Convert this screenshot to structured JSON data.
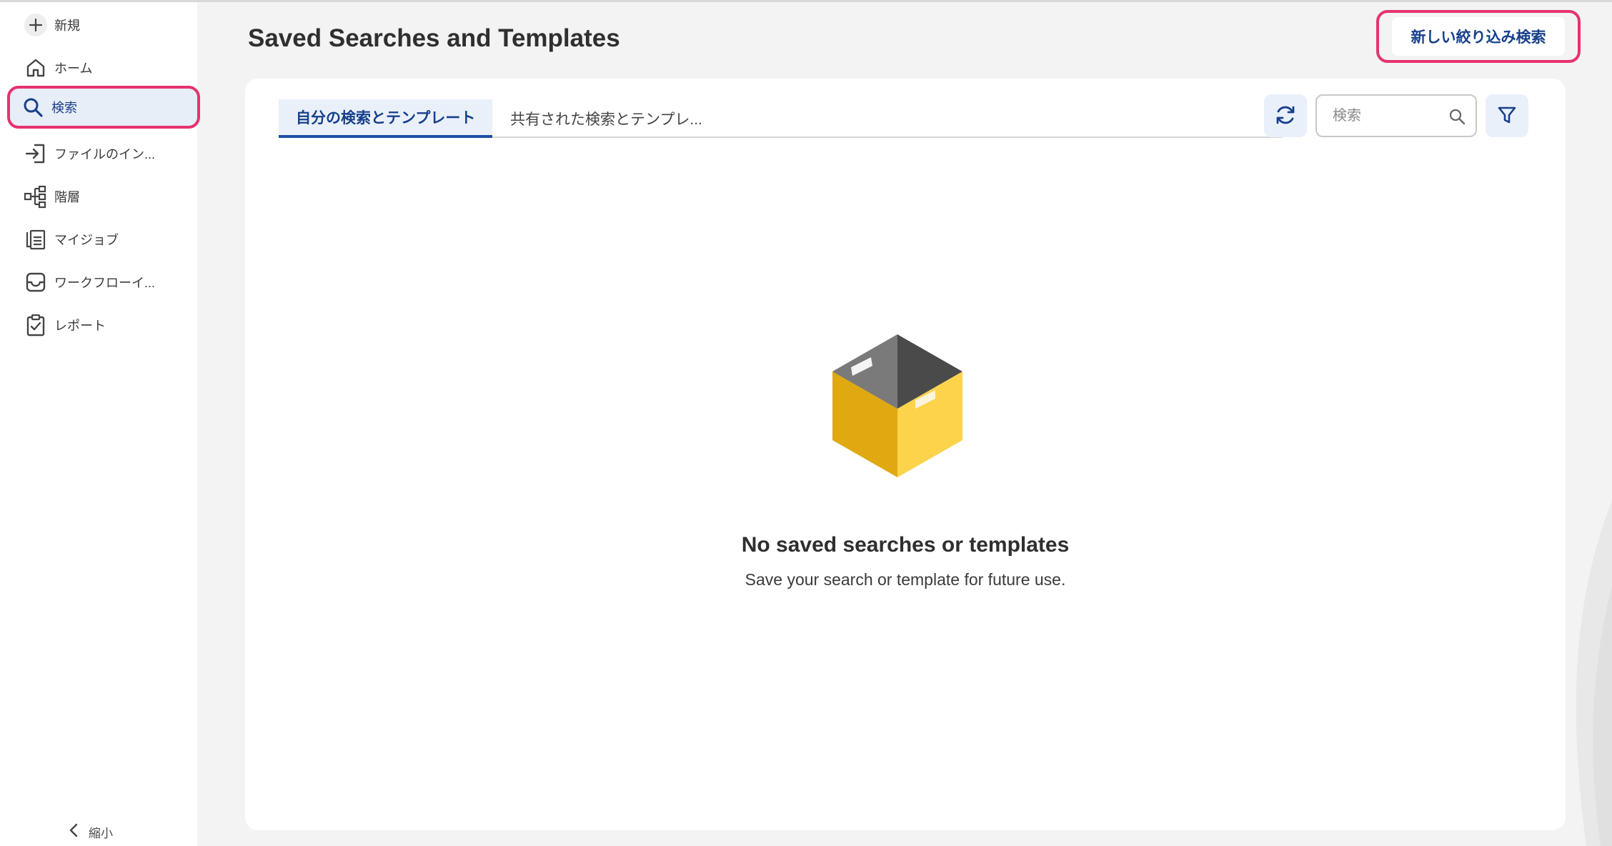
{
  "sidebar": {
    "items": [
      {
        "label": "新規",
        "icon": "plus-icon"
      },
      {
        "label": "ホーム",
        "icon": "home-icon"
      },
      {
        "label": "検索",
        "icon": "search-icon"
      },
      {
        "label": "ファイルのイン...",
        "icon": "import-icon"
      },
      {
        "label": "階層",
        "icon": "hierarchy-icon"
      },
      {
        "label": "マイジョブ",
        "icon": "jobs-icon"
      },
      {
        "label": "ワークフローイ...",
        "icon": "inbox-icon"
      },
      {
        "label": "レポート",
        "icon": "clipboard-check-icon"
      }
    ],
    "collapse_label": "縮小"
  },
  "header": {
    "title": "Saved Searches and Templates",
    "new_filter_label": "新しい絞り込み検索"
  },
  "main": {
    "tabs": [
      {
        "label": "自分の検索とテンプレート",
        "active": true
      },
      {
        "label": "共有された検索とテンプレ...",
        "active": false
      }
    ],
    "search": {
      "placeholder": "検索",
      "value": ""
    },
    "empty": {
      "title": "No saved searches or templates",
      "subtitle": "Save your search or template for future use."
    }
  },
  "colors": {
    "accent": "#17408b",
    "highlight": "#e6336f",
    "active_bg": "#eaf0fa",
    "box_yellow": "#f5c23a",
    "box_dark": "#4a4a4a"
  }
}
